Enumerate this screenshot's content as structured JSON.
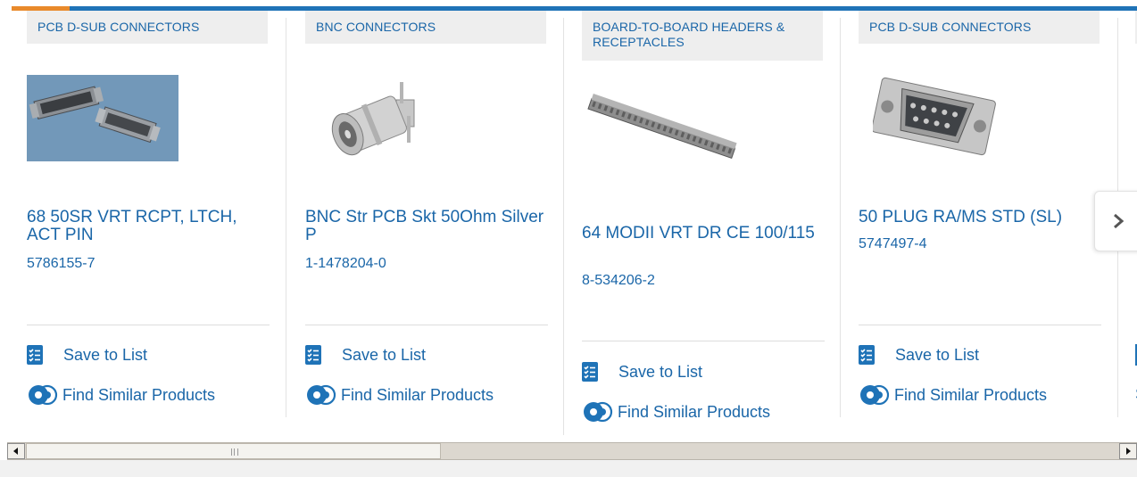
{
  "products": [
    {
      "category": "PCB D-SUB CONNECTORS",
      "title": "68 50SR VRT RCPT, LTCH, ACT PIN",
      "part_number": "5786155-7",
      "image": "dsub-receptacle-pair-photo",
      "save_label": "Save to List",
      "similar_label": "Find Similar Products"
    },
    {
      "category": "BNC CONNECTORS",
      "title": "BNC Str PCB Skt 50Ohm Silver P",
      "part_number": "1-1478204-0",
      "image": "bnc-socket-photo",
      "save_label": "Save to List",
      "similar_label": "Find Similar Products"
    },
    {
      "category": "BOARD-TO-BOARD HEADERS & RECEPTACLES",
      "title": "64 MODII VRT DR CE 100/115",
      "part_number": "8-534206-2",
      "image": "header-strip-photo",
      "save_label": "Save to List",
      "similar_label": "Find Similar Products"
    },
    {
      "category": "PCB D-SUB CONNECTORS",
      "title": "50 PLUG RA/MS STD (SL)",
      "part_number": "5747497-4",
      "image": "dsub-plug-photo",
      "save_label": "Save to List",
      "similar_label": "Find Similar Products"
    }
  ],
  "peek_card": {
    "similar_partial": "S"
  },
  "next_button_icon": "chevron-right-icon",
  "colors": {
    "link": "#1a66a8",
    "accent": "#e98a2b",
    "brand": "#1f73b7"
  }
}
